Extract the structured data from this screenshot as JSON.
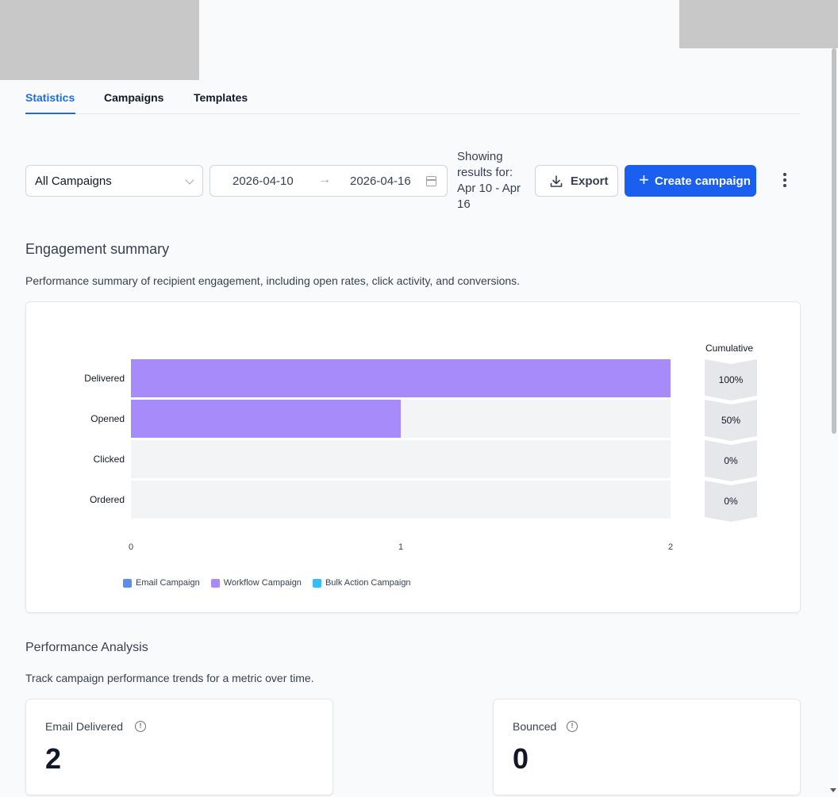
{
  "tabs": [
    {
      "label": "Statistics",
      "active": true
    },
    {
      "label": "Campaigns",
      "active": false
    },
    {
      "label": "Templates",
      "active": false
    }
  ],
  "filters": {
    "campaign_select": "All Campaigns",
    "date_start": "2026-04-10",
    "date_end": "2026-04-16",
    "showing_text": "Showing results for: Apr 10 - Apr 16"
  },
  "actions": {
    "export_label": "Export",
    "create_label": "Create campaign"
  },
  "engagement": {
    "title": "Engagement summary",
    "description": "Performance summary of recipient engagement, including open rates, click activity, and conversions.",
    "cumulative_title": "Cumulative"
  },
  "chart_data": {
    "type": "bar",
    "orientation": "horizontal",
    "stacked": true,
    "categories": [
      "Delivered",
      "Opened",
      "Clicked",
      "Ordered"
    ],
    "x_ticks": [
      "0",
      "1",
      "2"
    ],
    "xlim": [
      0,
      2
    ],
    "series": [
      {
        "name": "Email Campaign",
        "color": "#5b8def",
        "values": [
          0,
          0,
          0,
          0
        ]
      },
      {
        "name": "Workflow Campaign",
        "color": "#a78bfa",
        "values": [
          2,
          1,
          0,
          0
        ]
      },
      {
        "name": "Bulk Action Campaign",
        "color": "#38bdf8",
        "values": [
          0,
          0,
          0,
          0
        ]
      }
    ],
    "cumulative": [
      "100%",
      "50%",
      "0%",
      "0%"
    ],
    "legend_position": "bottom-left",
    "background_bar_color": "#f3f4f6"
  },
  "performance": {
    "title": "Performance Analysis",
    "description": "Track campaign performance trends for a metric over time.",
    "metrics": [
      {
        "label": "Email Delivered",
        "value": "2"
      },
      {
        "label": "Bounced",
        "value": "0"
      }
    ]
  },
  "icons": {
    "info": "info-icon",
    "export": "download-icon",
    "calendar": "calendar-icon",
    "more": "kebab-icon"
  }
}
